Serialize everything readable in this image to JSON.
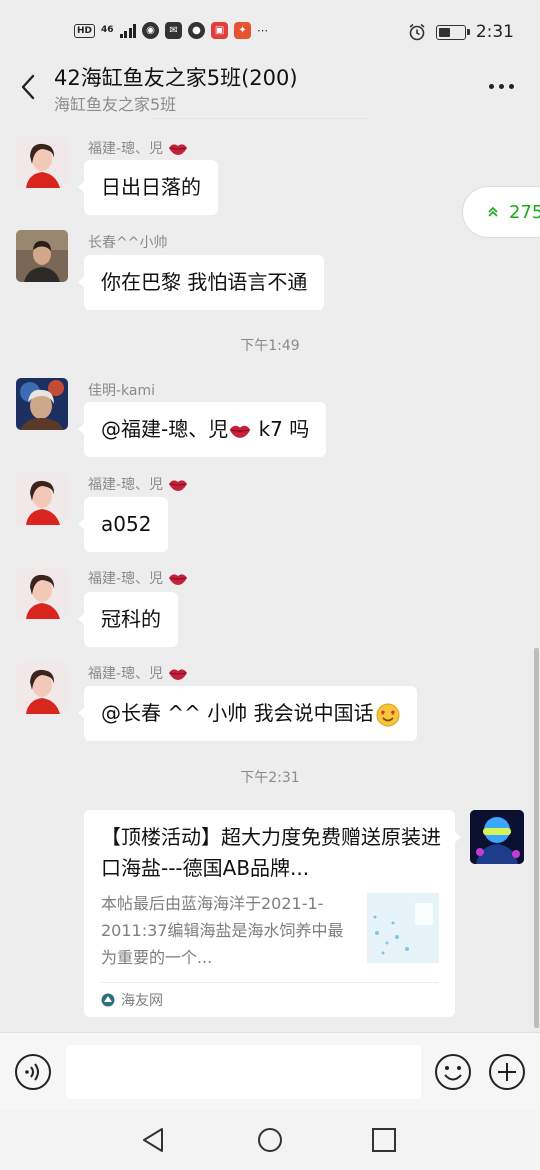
{
  "status_bar": {
    "hd": "HD",
    "network": "46",
    "time": "2:31",
    "battery_level": 0.5,
    "app_badge": "⋯"
  },
  "header": {
    "title": "42海缸鱼友之家5班(200)",
    "subtitle": "海缸鱼友之家5班"
  },
  "unread": {
    "count": "275"
  },
  "messages": [
    {
      "sender": "福建-璁、児",
      "text": "日出日落的"
    },
    {
      "sender": "长春^^小帅",
      "text": "你在巴黎 我怕语言不通"
    },
    {
      "sender": "佳明-kami",
      "text_pre": "@福建-璁、児",
      "text_post": " k7 吗"
    },
    {
      "sender": "福建-璁、児",
      "text": "a052"
    },
    {
      "sender": "福建-璁、児",
      "text": "冠科的"
    },
    {
      "sender": "福建-璁、児",
      "text": "@长春 ^^ 小帅   我会说中国话"
    }
  ],
  "timestamps": [
    "下午1:49",
    "下午2:31"
  ],
  "link_card": {
    "title": "【顶楼活动】超大力度免费赠送原装进口海盐---德国AB品牌...",
    "description": "本帖最后由蓝海海洋于2021-1-2011:37编辑海盐是海水饲养中最为重要的一个...",
    "source": "海友网"
  },
  "input_bar": {
    "placeholder": ""
  },
  "icons": {
    "back": "back-arrow-icon",
    "more": "more-icon",
    "voice": "voice-icon",
    "emoji": "emoji-icon",
    "plus": "plus-icon",
    "lips": "lips-icon",
    "alarm": "alarm-icon"
  },
  "colors": {
    "background": "#ededed",
    "bubble": "#ffffff",
    "accent_green": "#1aad19",
    "secondary_text": "#8a8a8a"
  }
}
